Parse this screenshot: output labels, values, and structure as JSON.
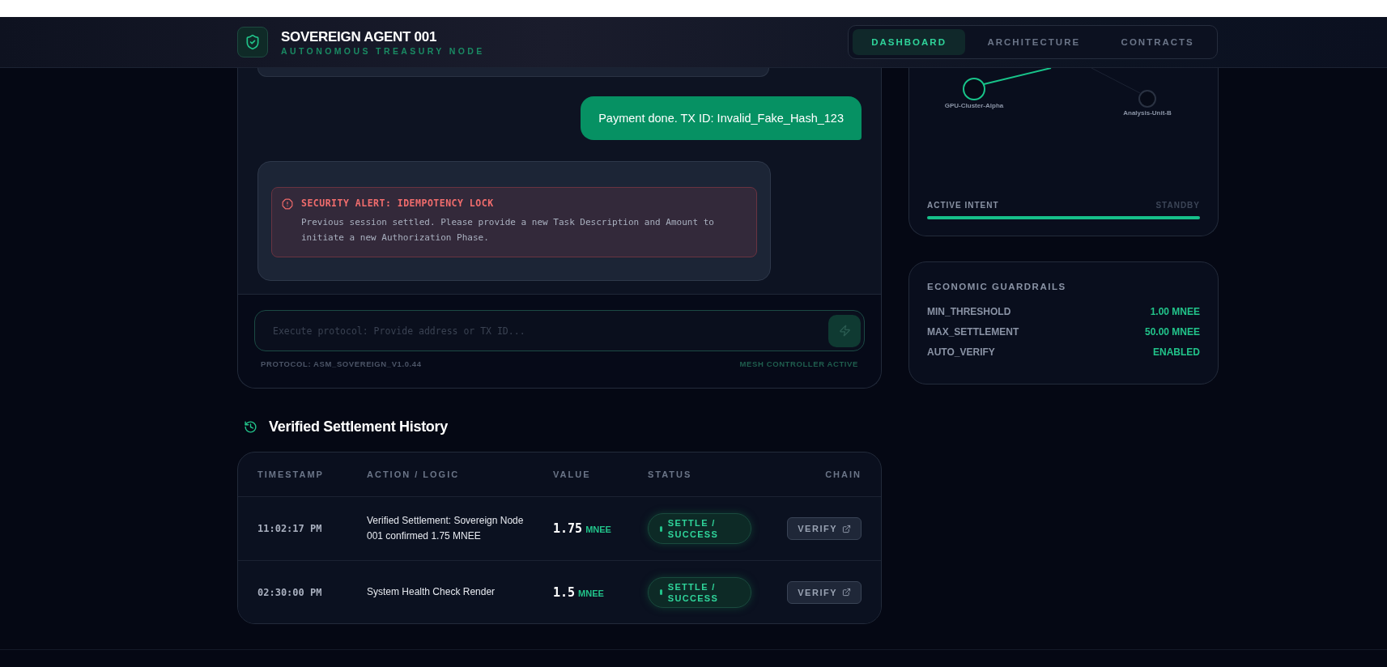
{
  "brand": {
    "title": "SOVEREIGN AGENT 001",
    "subtitle": "AUTONOMOUS TREASURY NODE"
  },
  "nav": [
    {
      "label": "DASHBOARD",
      "selected": true
    },
    {
      "label": "ARCHITECTURE",
      "selected": false
    },
    {
      "label": "CONTRACTS",
      "selected": false
    }
  ],
  "chat": {
    "messages": [
      {
        "kind": "user",
        "text": "Payment done. TX ID: Invalid_Fake_Hash_123"
      },
      {
        "kind": "alert",
        "title": "SECURITY ALERT: IDEMPOTENCY LOCK",
        "body": "Previous session settled. Please provide a new Task Description and Amount to initiate a new Authorization Phase."
      }
    ],
    "input": {
      "placeholder": "Execute protocol: Provide address or TX ID..."
    },
    "protocol": "PROTOCOL: ASM_SOVEREIGN_V1.0.44",
    "controller": "MESH CONTROLLER ACTIVE"
  },
  "mesh": {
    "nodes": [
      {
        "label": "GPU-Cluster-Alpha",
        "active": true
      },
      {
        "label": "Analysis-Unit-B",
        "active": false
      }
    ],
    "intent": {
      "label": "ACTIVE INTENT",
      "state": "STANDBY",
      "level": 1
    }
  },
  "guardrails": {
    "title": "ECONOMIC GUARDRAILS",
    "rows": [
      {
        "label": "MIN_THRESHOLD",
        "value": "1.00 MNEE"
      },
      {
        "label": "MAX_SETTLEMENT",
        "value": "50.00 MNEE"
      },
      {
        "label": "AUTO_VERIFY",
        "value": "ENABLED"
      }
    ]
  },
  "history": {
    "title": "Verified Settlement History",
    "columns": [
      "TIMESTAMP",
      "ACTION / LOGIC",
      "VALUE",
      "STATUS",
      "CHAIN"
    ],
    "rows": [
      {
        "timestamp": "11:02:17 PM",
        "action": "Verified Settlement: Sovereign Node 001 confirmed 1.75 MNEE",
        "amount": "1.75",
        "unit": "MNEE",
        "status": "SETTLE / SUCCESS",
        "button": "VERIFY"
      },
      {
        "timestamp": "02:30:00 PM",
        "action": "System Health Check Render",
        "amount": "1.5",
        "unit": "MNEE",
        "status": "SETTLE / SUCCESS",
        "button": "VERIFY"
      }
    ]
  }
}
